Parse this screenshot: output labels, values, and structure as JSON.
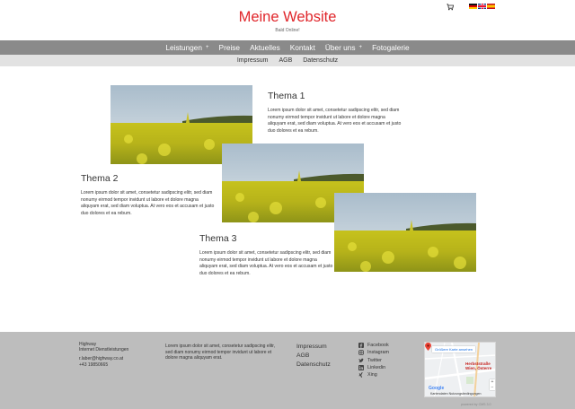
{
  "header": {
    "title": "Meine Website",
    "tagline": "Bald Online!",
    "cart_icon": "shopping-cart-icon",
    "languages": [
      {
        "code": "de",
        "icon": "flag-germany-icon"
      },
      {
        "code": "en",
        "icon": "flag-uk-icon"
      },
      {
        "code": "es",
        "icon": "flag-spain-icon"
      }
    ]
  },
  "main_nav": {
    "items": [
      {
        "label": "Leistungen",
        "has_submenu": true
      },
      {
        "label": "Preise",
        "has_submenu": false
      },
      {
        "label": "Aktuelles",
        "has_submenu": false
      },
      {
        "label": "Kontakt",
        "has_submenu": false
      },
      {
        "label": "Über uns",
        "has_submenu": true
      },
      {
        "label": "Fotogalerie",
        "has_submenu": false
      }
    ],
    "submenu_marker": "+"
  },
  "sub_nav": {
    "items": [
      "Impressum",
      "AGB",
      "Datenschutz"
    ]
  },
  "topics": [
    {
      "title": "Thema 1",
      "text": "Lorem ipsum dolor sit amet, consetetur sadipscing elitr, sed diam nonumy eirmod tempor invidunt ut labore et dolore magna aliquyam erat, sed diam voluptua. At vero eos et accusam et justo duo dolores et ea rebum."
    },
    {
      "title": "Thema 2",
      "text": "Lorem ipsum dolor sit amet, consetetur sadipscing elitr, sed diam nonumy eirmod tempor invidunt ut labore et dolore magna aliquyam erat, sed diam voluptua. At vero eos et accusam et justo duo dolores et ea rebum."
    },
    {
      "title": "Thema 3",
      "text": "Lorem ipsum dolor sit amet, consetetur sadipscing elitr, sed diam nonumy eirmod tempor invidunt ut labore et dolore magna aliquyam erat, sed diam voluptua. At vero eos et accusam et justo duo dolores et ea rebum."
    }
  ],
  "footer": {
    "company": {
      "name": "Highway",
      "subtitle": "Internet Dienstleistungen",
      "email": "r.laber@highway.co.at",
      "phone": "+43 19850665"
    },
    "lorem": "Lorem ipsum dolor sit amet, consetetur sadipscing elitr, sed diam nonumy eirmod tempor invidunt ut labore et dolore magna aliquyam erat.",
    "links": [
      "Impressum",
      "AGB",
      "Datenschutz"
    ],
    "social": [
      {
        "label": "Facebook",
        "icon": "facebook-icon"
      },
      {
        "label": "Instagram",
        "icon": "instagram-icon"
      },
      {
        "label": "Twitter",
        "icon": "twitter-icon"
      },
      {
        "label": "Linkedin",
        "icon": "linkedin-icon"
      },
      {
        "label": "Xing",
        "icon": "xing-icon"
      }
    ],
    "map": {
      "button": "Größere Karte ansehen",
      "place_line1": "Herbststraße",
      "place_line2": "Wien, Österre",
      "logo": "Google",
      "terms": "Kartendaten   Nutzungsbedingungen"
    },
    "credit": "powered by CMS 3.0"
  },
  "colors": {
    "title": "#e0262b",
    "nav_bg": "#8a8a8a",
    "subnav_bg": "#e2e2e2",
    "footer_bg": "#bdbdbd"
  }
}
